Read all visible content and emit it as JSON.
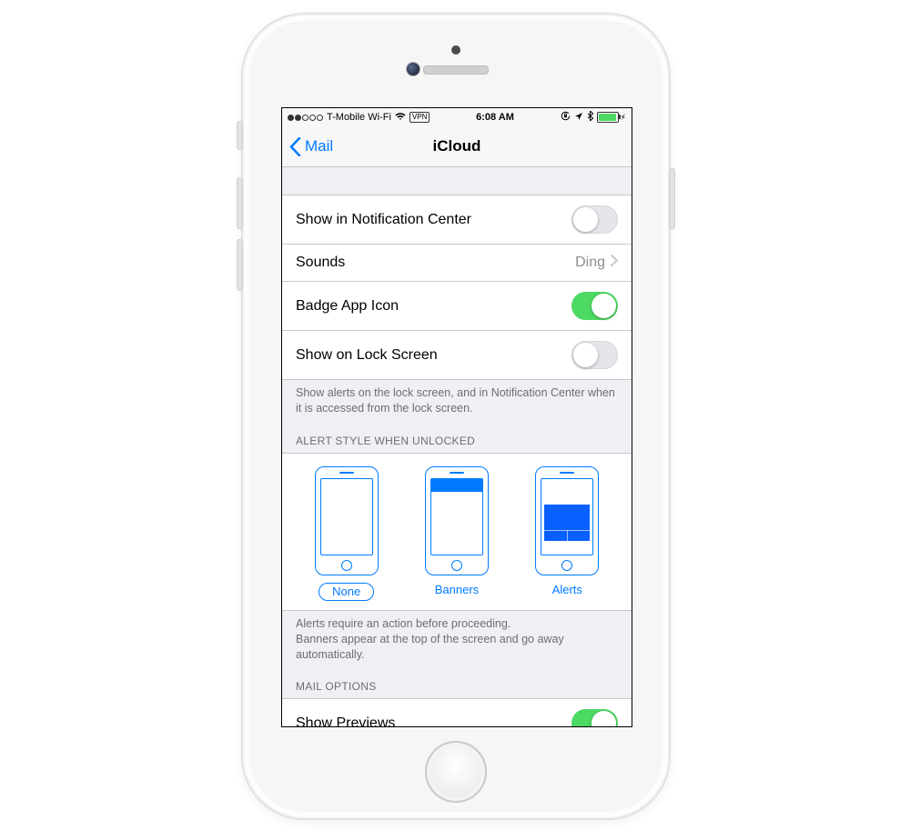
{
  "statusbar": {
    "carrier": "T-Mobile Wi-Fi",
    "vpn": "VPN",
    "time": "6:08 AM"
  },
  "nav": {
    "back_label": "Mail",
    "title": "iCloud"
  },
  "rows": {
    "show_nc": {
      "label": "Show in Notification Center",
      "state": "off"
    },
    "sounds": {
      "label": "Sounds",
      "value": "Ding"
    },
    "badge": {
      "label": "Badge App Icon",
      "state": "on"
    },
    "lockscr": {
      "label": "Show on Lock Screen",
      "state": "off"
    }
  },
  "footer1": "Show alerts on the lock screen, and in Notification Center when it is accessed from the lock screen.",
  "alert_style": {
    "header": "ALERT STYLE WHEN UNLOCKED",
    "options": {
      "none": "None",
      "banners": "Banners",
      "alerts": "Alerts"
    },
    "selected": "none",
    "footer": "Alerts require an action before proceeding.\nBanners appear at the top of the screen and go away automatically."
  },
  "mail_options": {
    "header": "MAIL OPTIONS",
    "show_previews": {
      "label": "Show Previews",
      "state": "on"
    }
  }
}
